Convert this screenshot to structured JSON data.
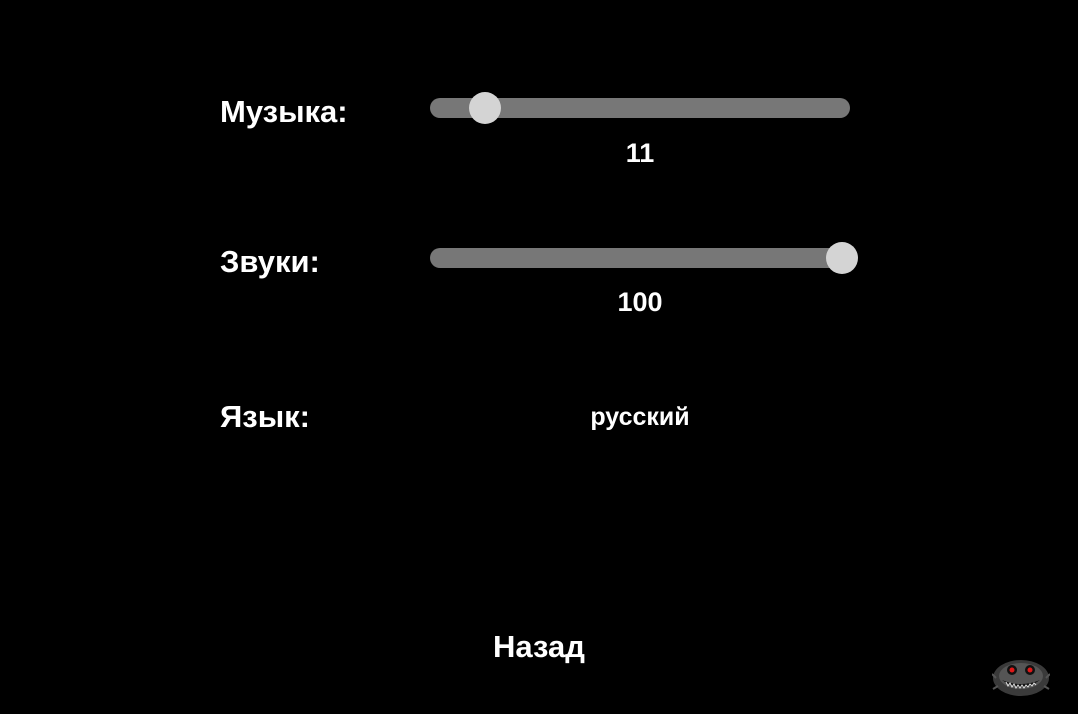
{
  "settings": {
    "music": {
      "label": "Музыка:",
      "value": "11",
      "level_percent": 11
    },
    "sounds": {
      "label": "Звуки:",
      "value": "100",
      "level_percent": 100
    },
    "language": {
      "label": "Язык:",
      "value": "русский"
    }
  },
  "back_label": "Назад",
  "colors": {
    "background": "#000000",
    "text": "#ffffff",
    "track": "#777777",
    "thumb": "#d4d4d4",
    "mascot_eyes": "#e01818"
  },
  "icons": {
    "corner": "monster-face-icon"
  }
}
